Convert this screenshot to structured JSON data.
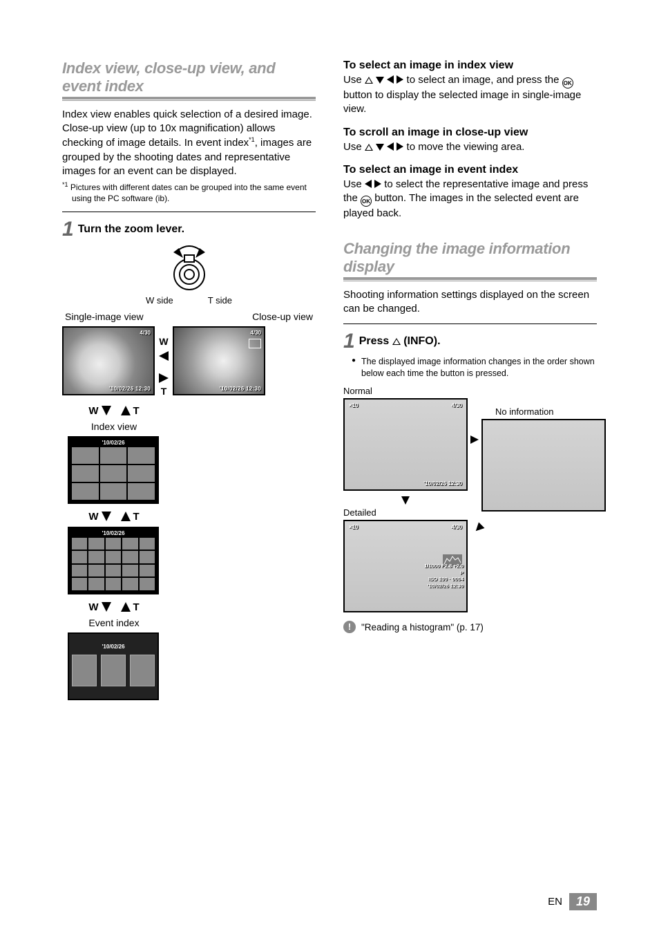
{
  "left": {
    "section_title": "Index view, close-up view, and event index",
    "intro": "Index view enables quick selection of a desired image. Close-up view (up to 10x magnification) allows checking of image details. In event index*1, images are grouped by the shooting dates and representative images for an event can be displayed.",
    "footnote_marker": "*1",
    "footnote": "Pictures with different dates can be grouped into the same event using the PC software (ib).",
    "step1": "Turn the zoom lever.",
    "w_side": "W side",
    "t_side": "T side",
    "single_label": "Single-image view",
    "close_label": "Close-up view",
    "w": "W",
    "t": "T",
    "counter": "4/30",
    "date_time": "'10/02/26 12:30",
    "index_label": "Index view",
    "grid_date": "'10/02/26",
    "event_label": "Event index"
  },
  "right": {
    "sub1_title": "To select an image in index view",
    "sub1_body_a": "Use ",
    "sub1_body_b": " to select an image, and press the ",
    "sub1_body_c": " button to display the selected image in single-image view.",
    "sub2_title": "To scroll an image in close-up view",
    "sub2_body_a": "Use ",
    "sub2_body_b": " to move the viewing area.",
    "sub3_title": "To select an image in event index",
    "sub3_body_a": "Use ",
    "sub3_body_b": " to select the representative image and press the ",
    "sub3_body_c": " button. The images in the selected event are played back.",
    "section2_title": "Changing the image information display",
    "section2_intro": "Shooting information settings displayed on the screen can be changed.",
    "step1": "Press ",
    "step1_tail": " (INFO).",
    "bullet": "The displayed image information changes in the order shown below each time the button is pressed.",
    "lbl_normal": "Normal",
    "lbl_noinfo": "No information",
    "lbl_detailed": "Detailed",
    "counter": "4/30",
    "date_time": "'10/02/26 12:30",
    "det_line1": "1/1000  F2.8  +2.0",
    "det_line2": "P",
    "det_line3": "ISO 100 · 0004",
    "det_line4": "'10/02/26  12:30",
    "icons_row": "×10",
    "ref": "\"Reading a histogram\" (p. 17)",
    "ok": "OK"
  },
  "footer": {
    "lang": "EN",
    "page": "19"
  }
}
